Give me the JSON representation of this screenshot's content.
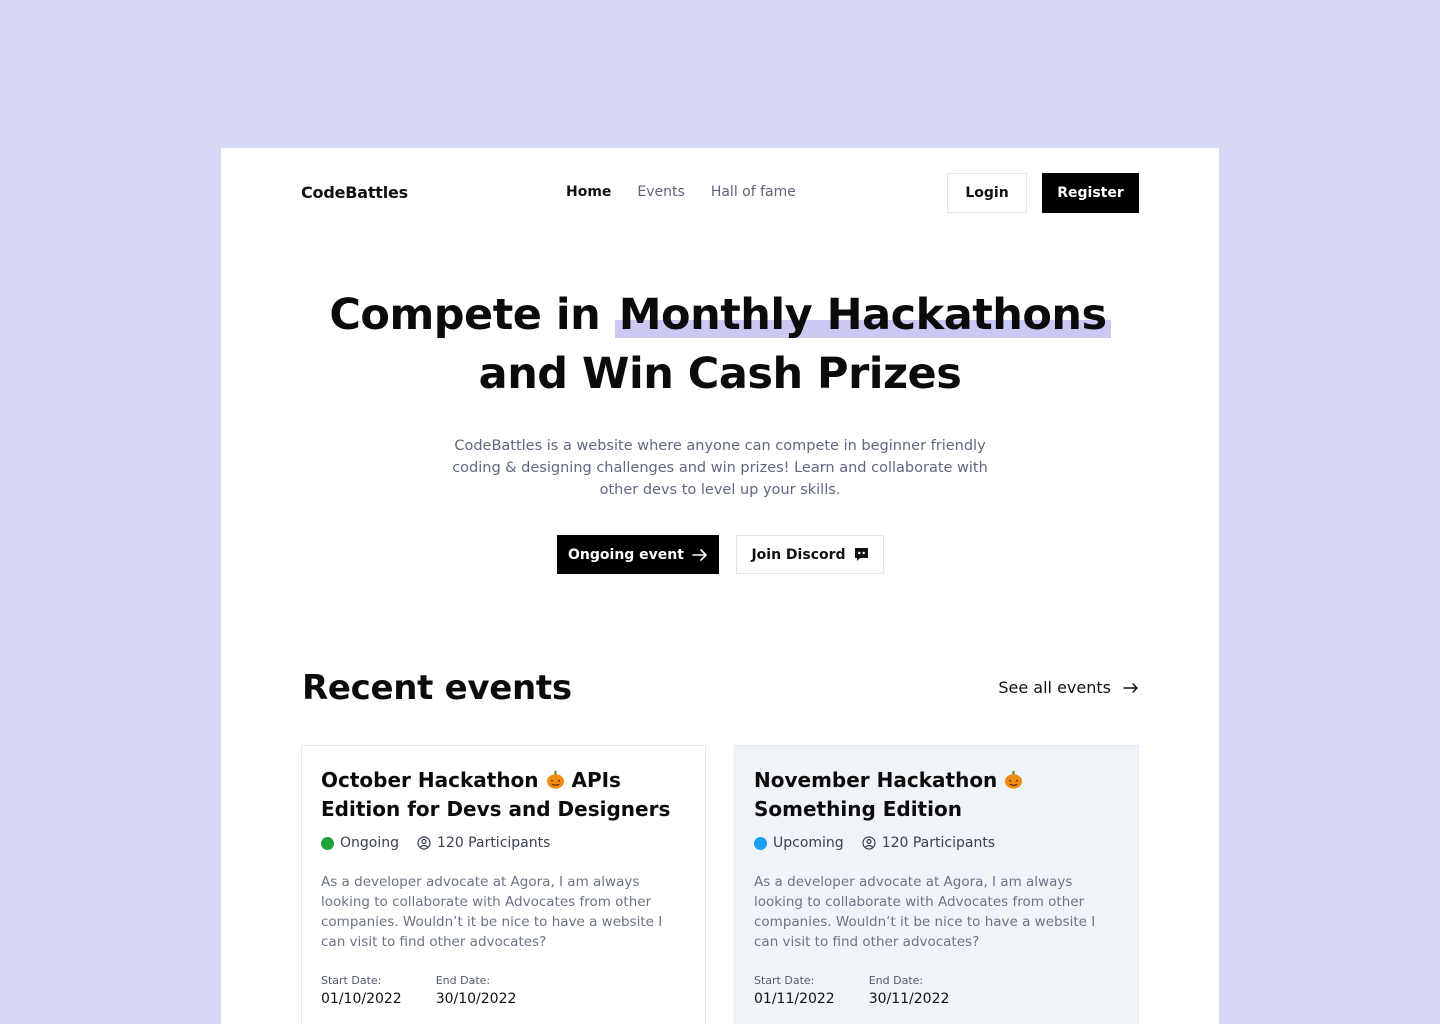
{
  "nav": {
    "logo": "CodeBattles",
    "links": [
      {
        "label": "Home",
        "active": true
      },
      {
        "label": "Events",
        "active": false
      },
      {
        "label": "Hall of fame",
        "active": false
      }
    ],
    "login_label": "Login",
    "register_label": "Register"
  },
  "hero": {
    "title_part1": "Compete in",
    "title_highlight": "Monthly Hackathons",
    "title_part2": "and Win Cash Prizes",
    "description": "CodeBattles is a website where anyone can compete in beginner friendly coding & designing challenges and win prizes! Learn and collaborate with other devs to level up your skills.",
    "ongoing_button": "Ongoing event",
    "discord_button": "Join Discord"
  },
  "recent": {
    "title": "Recent events",
    "see_all": "See all events",
    "events": [
      {
        "title_before": "October Hackathon",
        "title_after": "APIs Edition for Devs and Designers",
        "status": "Ongoing",
        "status_color": "#22a23a",
        "participants": "120 Participants",
        "description": "As a developer advocate at Agora, I am always looking to collaborate with Advocates from other companies. Wouldn’t it be nice to have a website I can visit to find other advocates?",
        "start_label": "Start Date:",
        "start_date": "01/10/2022",
        "end_label": "End Date:",
        "end_date": "30/10/2022"
      },
      {
        "title_before": "November Hackathon",
        "title_after": "Something Edition",
        "status": "Upcoming",
        "status_color": "#1aa0f0",
        "participants": "120 Participants",
        "description": "As a developer advocate at Agora, I am always looking to collaborate with Advocates from other companies. Wouldn’t it be nice to have a website I can visit to find other advocates?",
        "start_label": "Start Date:",
        "start_date": "01/11/2022",
        "end_label": "End Date:",
        "end_date": "30/11/2022"
      }
    ]
  },
  "colors": {
    "background": "#d6d6f5",
    "highlight": "#c9c9f4",
    "primary_button": "#000000",
    "muted_text": "#5e6880"
  },
  "icons": {
    "arrow": "arrow-right-icon",
    "discord": "discord-icon",
    "participants": "user-circle-icon",
    "pumpkin": "pumpkin-icon"
  }
}
